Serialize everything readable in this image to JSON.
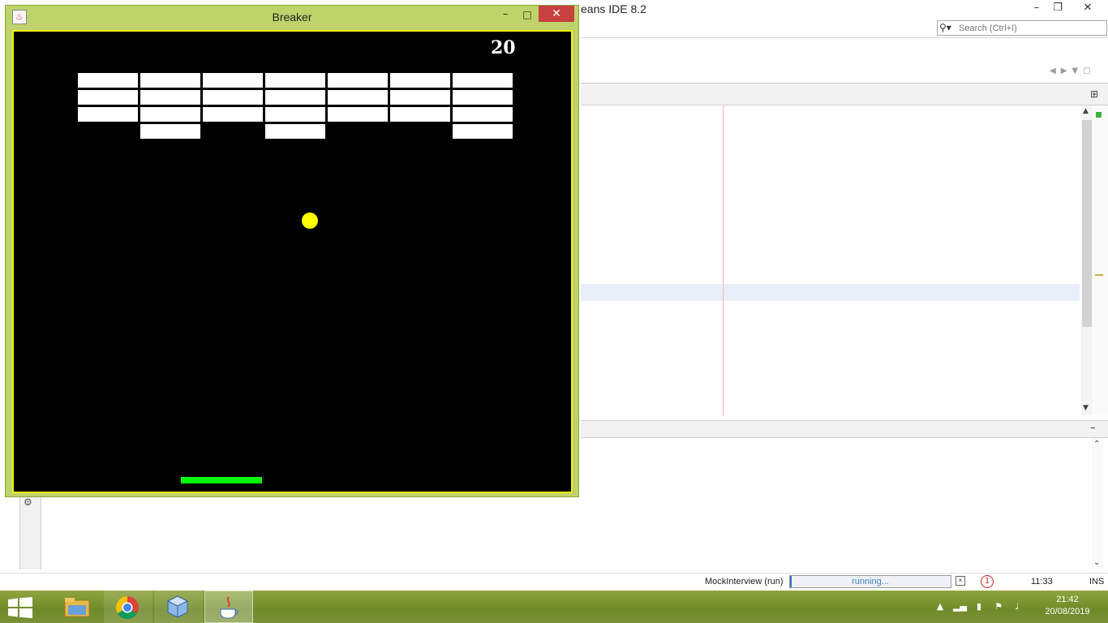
{
  "ide": {
    "title": "eans IDE 8.2",
    "search_placeholder": "Search (Ctrl+I)",
    "status": {
      "run_label": "MockInterview (run)",
      "progress_text": "running...",
      "notification_count": "1",
      "caret_position": "11:33",
      "insert_mode": "INS"
    }
  },
  "breaker": {
    "title": "Breaker",
    "score": "20",
    "bricks": {
      "columns": 7,
      "rows": [
        [
          1,
          1,
          1,
          1,
          1,
          1,
          1
        ],
        [
          1,
          1,
          1,
          1,
          1,
          1,
          1
        ],
        [
          1,
          1,
          1,
          1,
          1,
          1,
          1
        ],
        [
          0,
          1,
          0,
          1,
          0,
          0,
          1
        ]
      ]
    },
    "colors": {
      "background": "#000000",
      "brick": "#ffffff",
      "ball": "#ffff00",
      "paddle": "#00ff00",
      "border": "#f1f10e",
      "frame": "#bfd36b"
    }
  },
  "taskbar": {
    "apps": [
      "file-explorer-icon",
      "chrome-icon",
      "virtualbox-icon",
      "java-icon"
    ],
    "time": "21:42",
    "date": "20/08/2019"
  }
}
